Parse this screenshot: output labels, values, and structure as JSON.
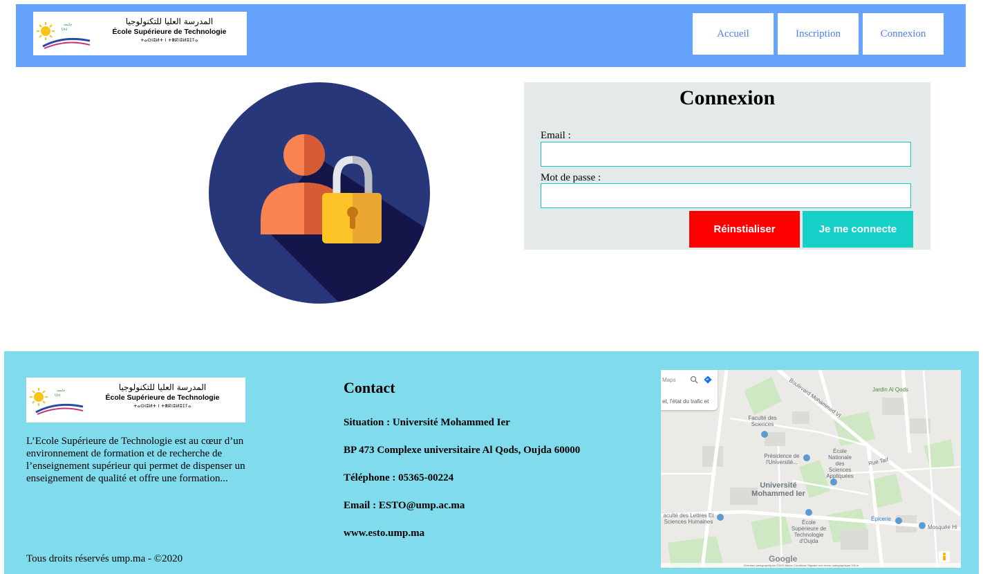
{
  "header": {
    "logo": {
      "arabic": "المدرسة العليا للتكنولوجيا",
      "french": "École Supérieure de Technologie",
      "tifinagh": "ⵜⴰⵙⵏⵓⵍⵜ ⵏ ⵜⴻⴽⵏⵓⵍⵓⵊⵢⴰ"
    },
    "nav": [
      "Accueil",
      "Inscription",
      "Connexion"
    ]
  },
  "login": {
    "title": "Connexion",
    "email_label": "Email :",
    "email_value": "",
    "password_label": "Mot de passe :",
    "password_value": "",
    "reset_label": "Réinstialiser",
    "submit_label": "Je me connecte"
  },
  "footer": {
    "logo": {
      "arabic": "المدرسة العليا للتكنولوجيا",
      "french": "École Supérieure de Technologie",
      "tifinagh": "ⵜⴰⵙⵏⵓⵍⵜ ⵏ ⵜⴻⴽⵏⵓⵍⵓⵊⵢⴰ"
    },
    "description": "L’Ecole Supérieure de Technologie est au cœur d’un environnement de formation et de recherche de l’enseignement supérieur qui permet de dispenser un enseignement de qualité et offre une formation...",
    "copyright": "Tous droits réservés ump.ma - ©2020",
    "contact": {
      "title": "Contact",
      "lines": [
        "Situation : Université Mohammed Ier",
        "BP 473 Complexe universitaire Al Qods, Oujda 60000",
        "Téléphone : 05365-00224",
        "Email : ESTO@ump.ac.ma",
        "www.esto.ump.ma"
      ]
    },
    "map": {
      "search_text": "Maps",
      "info_text": "et, l'état du trafic et",
      "labels": [
        "Jardin Al Qods",
        "Faculté des Sciences",
        "Présidence de l'Université...",
        "École Nationale des Sciences Appliquées",
        "Université Mohammed Ier",
        "aculté des Lettres Et Sciences Humaines",
        "École Supérieure de Technologie d'Oujda",
        "Épicerie",
        "Mosquée Hi",
        "Boulevard Mohammed VI",
        "Rue Taif"
      ],
      "brand": "Google",
      "attribution": "Données cartographiques ©2020   Maroc   Conditions   Signaler une erreur cartographique   200 m"
    }
  },
  "colors": {
    "header_bg": "#66a3ff",
    "nav_text": "#4d7ff0",
    "panel_bg": "#e4e9e9",
    "input_border": "#17c6c0",
    "reset_bg": "#ff0000",
    "submit_bg": "#17d1c9",
    "footer_bg": "#80dced"
  },
  "icons": [
    "user-lock-icon",
    "sun-logo-icon",
    "map-pin-icon",
    "search-icon",
    "directions-icon",
    "pegman-icon"
  ]
}
